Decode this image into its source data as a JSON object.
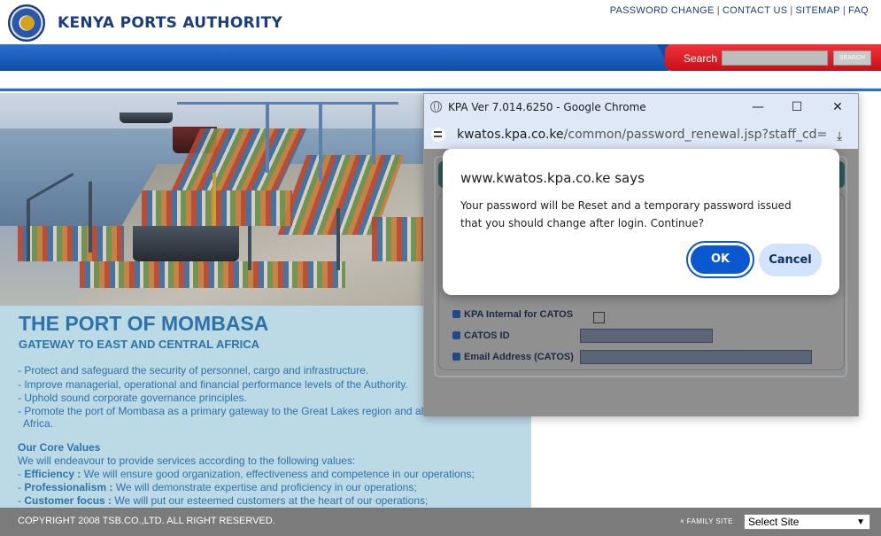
{
  "header": {
    "brand": "KENYA PORTS AUTHORITY",
    "links": [
      "PASSWORD CHANGE",
      "CONTACT US",
      "SITEMAP",
      "FAQ"
    ],
    "search_label": "Search",
    "search_button": "SEARCH"
  },
  "content": {
    "port_title": "THE PORT OF MOMBASA",
    "port_subtitle": "GATEWAY TO EAST AND CENTRAL AFRICA",
    "objectives": [
      "- Protect and safeguard the security of personnel, cargo and infrastructure.",
      "- Improve managerial, operational and financial performance levels of the Authority.",
      "- Uphold sound corporate governance principles.",
      "- Promote the port of Mombasa as a primary gateway to the Great Lakes region and al",
      "Africa."
    ],
    "core_values_title": "Our Core Values",
    "core_values_intro": "We will endeavour to provide services according to the following values:",
    "core_values": [
      {
        "term": "Efficiency :",
        "text": " We will ensure good organization, effectiveness and competence in our operations;"
      },
      {
        "term": "Professionalism :",
        "text": " We will demonstrate expertise and proficiency in our operations;"
      },
      {
        "term": "Customer focus :",
        "text": " We will put our esteemed customers at the heart of our operations;"
      }
    ]
  },
  "footer": {
    "copyright": "COPYRIGHT 2008 TSB.CO.,LTD. ALL RIGHT RESERVED.",
    "family_site_label": "× FAMILY SITE",
    "select_value": "Select Site"
  },
  "popup": {
    "window_title": "KPA Ver 7.014.6250 - Google Chrome",
    "address_host": "kwatos.kpa.co.ke",
    "address_path": "/common/password_renewal.jsp?staff_cd=",
    "form": {
      "internal_label": "KPA Internal for CATOS",
      "catos_id_label": "CATOS ID",
      "email_label": "Email Address (CATOS)"
    }
  },
  "alert": {
    "title": "www.kwatos.kpa.co.ke says",
    "message": "Your password will be Reset and a temporary password issued that you should change after login. Continue?",
    "ok_label": "OK",
    "cancel_label": "Cancel"
  }
}
